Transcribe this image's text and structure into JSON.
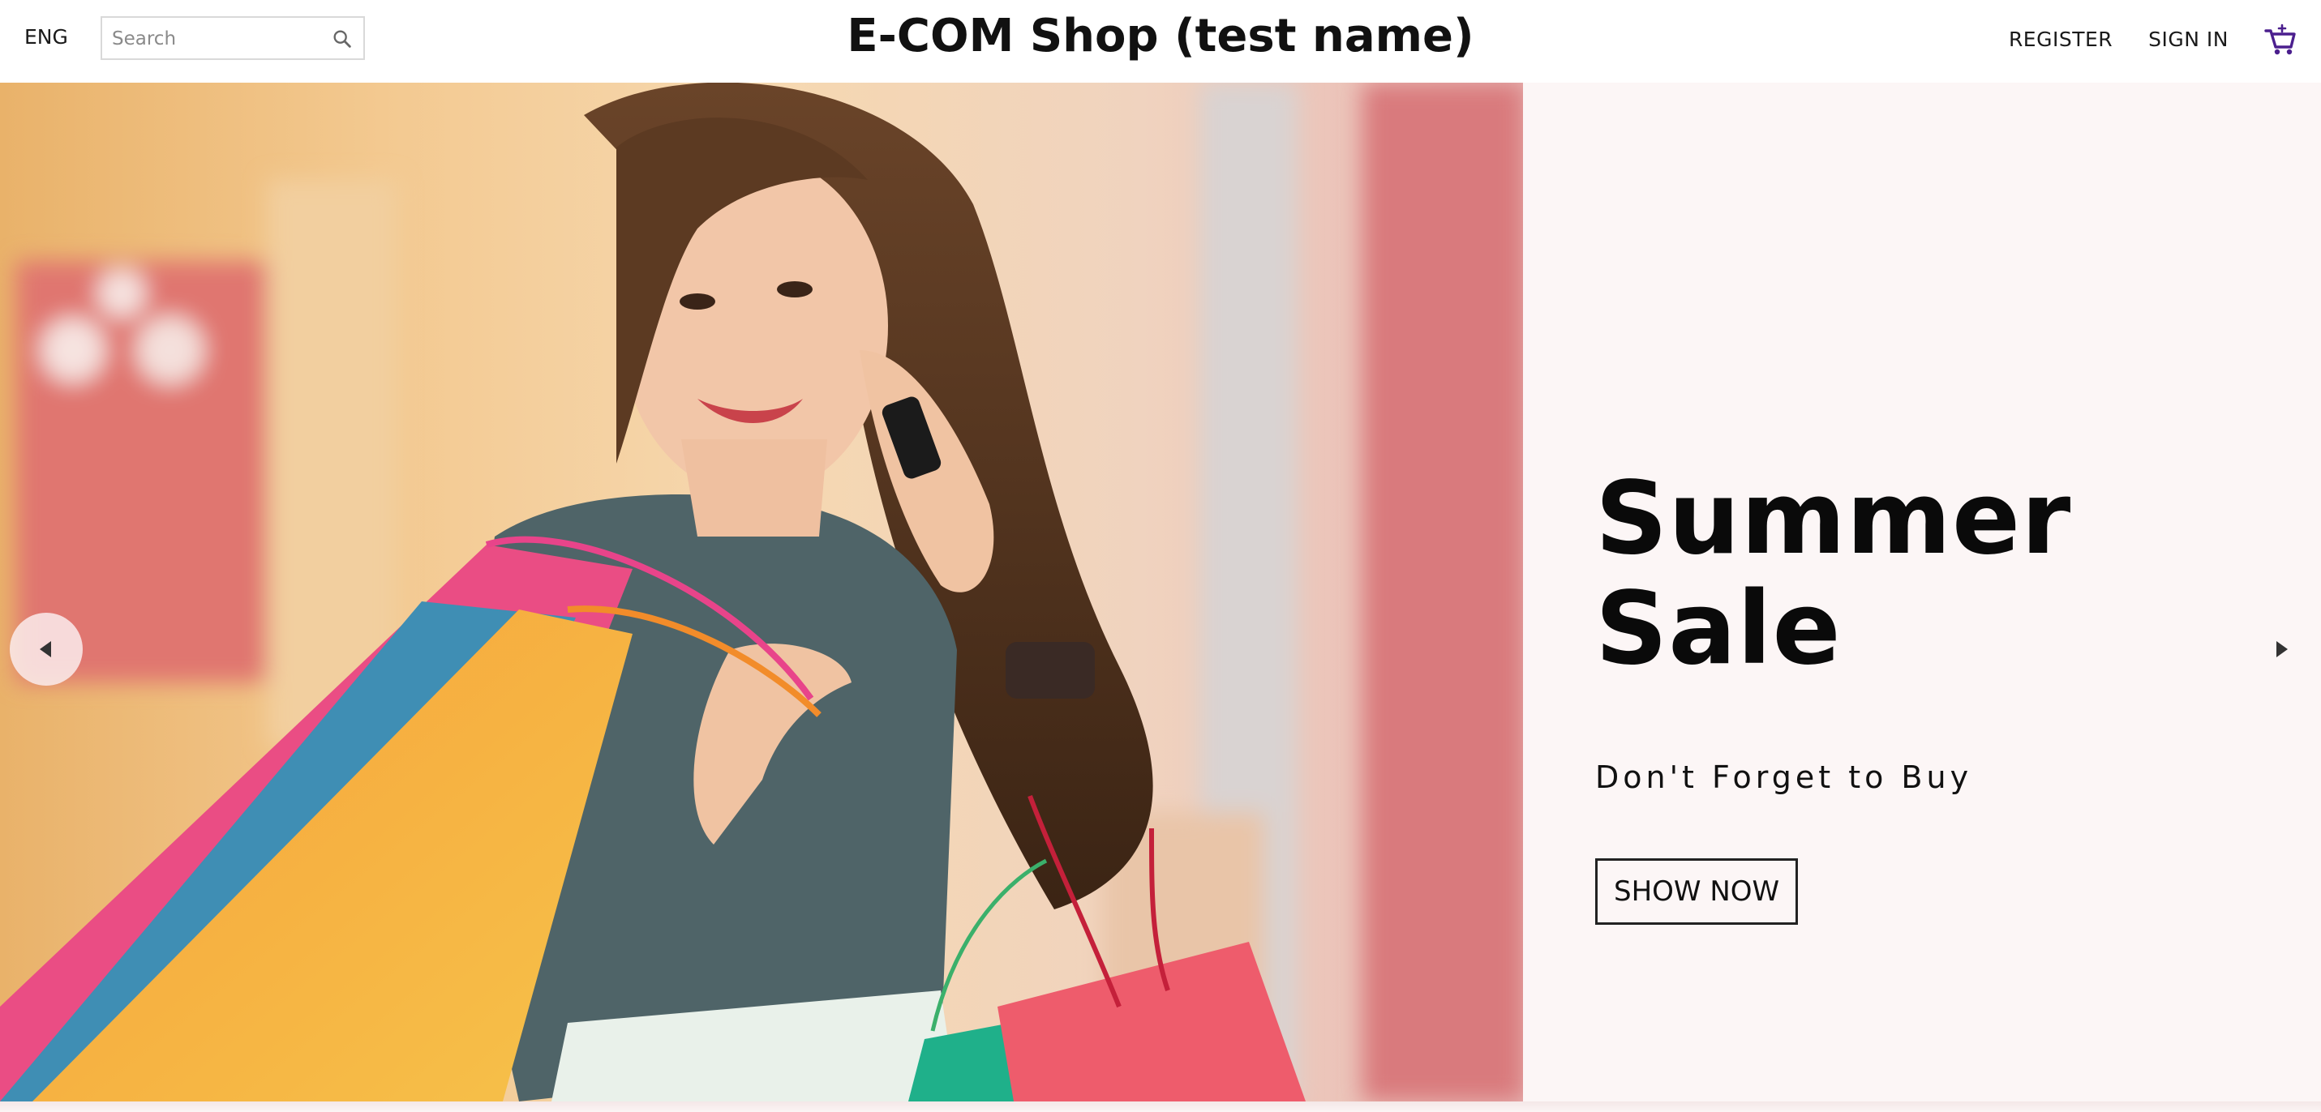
{
  "navbar": {
    "language": "ENG",
    "search_placeholder": "Search",
    "search_icon": "search-icon",
    "title": "E-COM Shop (test name)",
    "register_label": "REGISTER",
    "signin_label": "SIGN IN",
    "cart_icon": "shopping-cart-icon",
    "cart_accent_color": "#4b1f8e"
  },
  "slider": {
    "title": "Summer Sale",
    "description": "Don't Forget to Buy",
    "button_label": "SHOW NOW",
    "background_color": "#fcf6f6",
    "image_alt": "woman-with-shopping-bags",
    "left_arrow_icon": "arrow-left-icon",
    "right_arrow_icon": "arrow-right-icon"
  }
}
